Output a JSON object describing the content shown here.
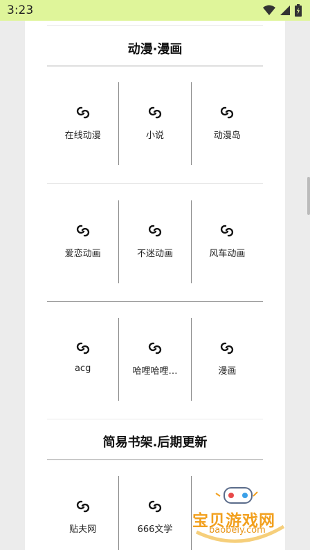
{
  "status_bar": {
    "time": "3:23"
  },
  "sections": [
    {
      "title": "动漫·漫画",
      "rows": [
        [
          "在线动漫",
          "小说",
          "动漫岛"
        ],
        [
          "爱恋动画",
          "不迷动画",
          "风车动画"
        ],
        [
          "acg",
          "哈哩哈哩…",
          "漫画"
        ]
      ]
    },
    {
      "title": "简易书架.后期更新",
      "rows": [
        [
          "贴夫网",
          "666文学",
          ""
        ]
      ]
    }
  ],
  "watermark": {
    "name": "宝贝游戏网",
    "url": "baobeiy.com"
  },
  "icons": {
    "item": "link-icon",
    "accent": "#dff59a"
  }
}
